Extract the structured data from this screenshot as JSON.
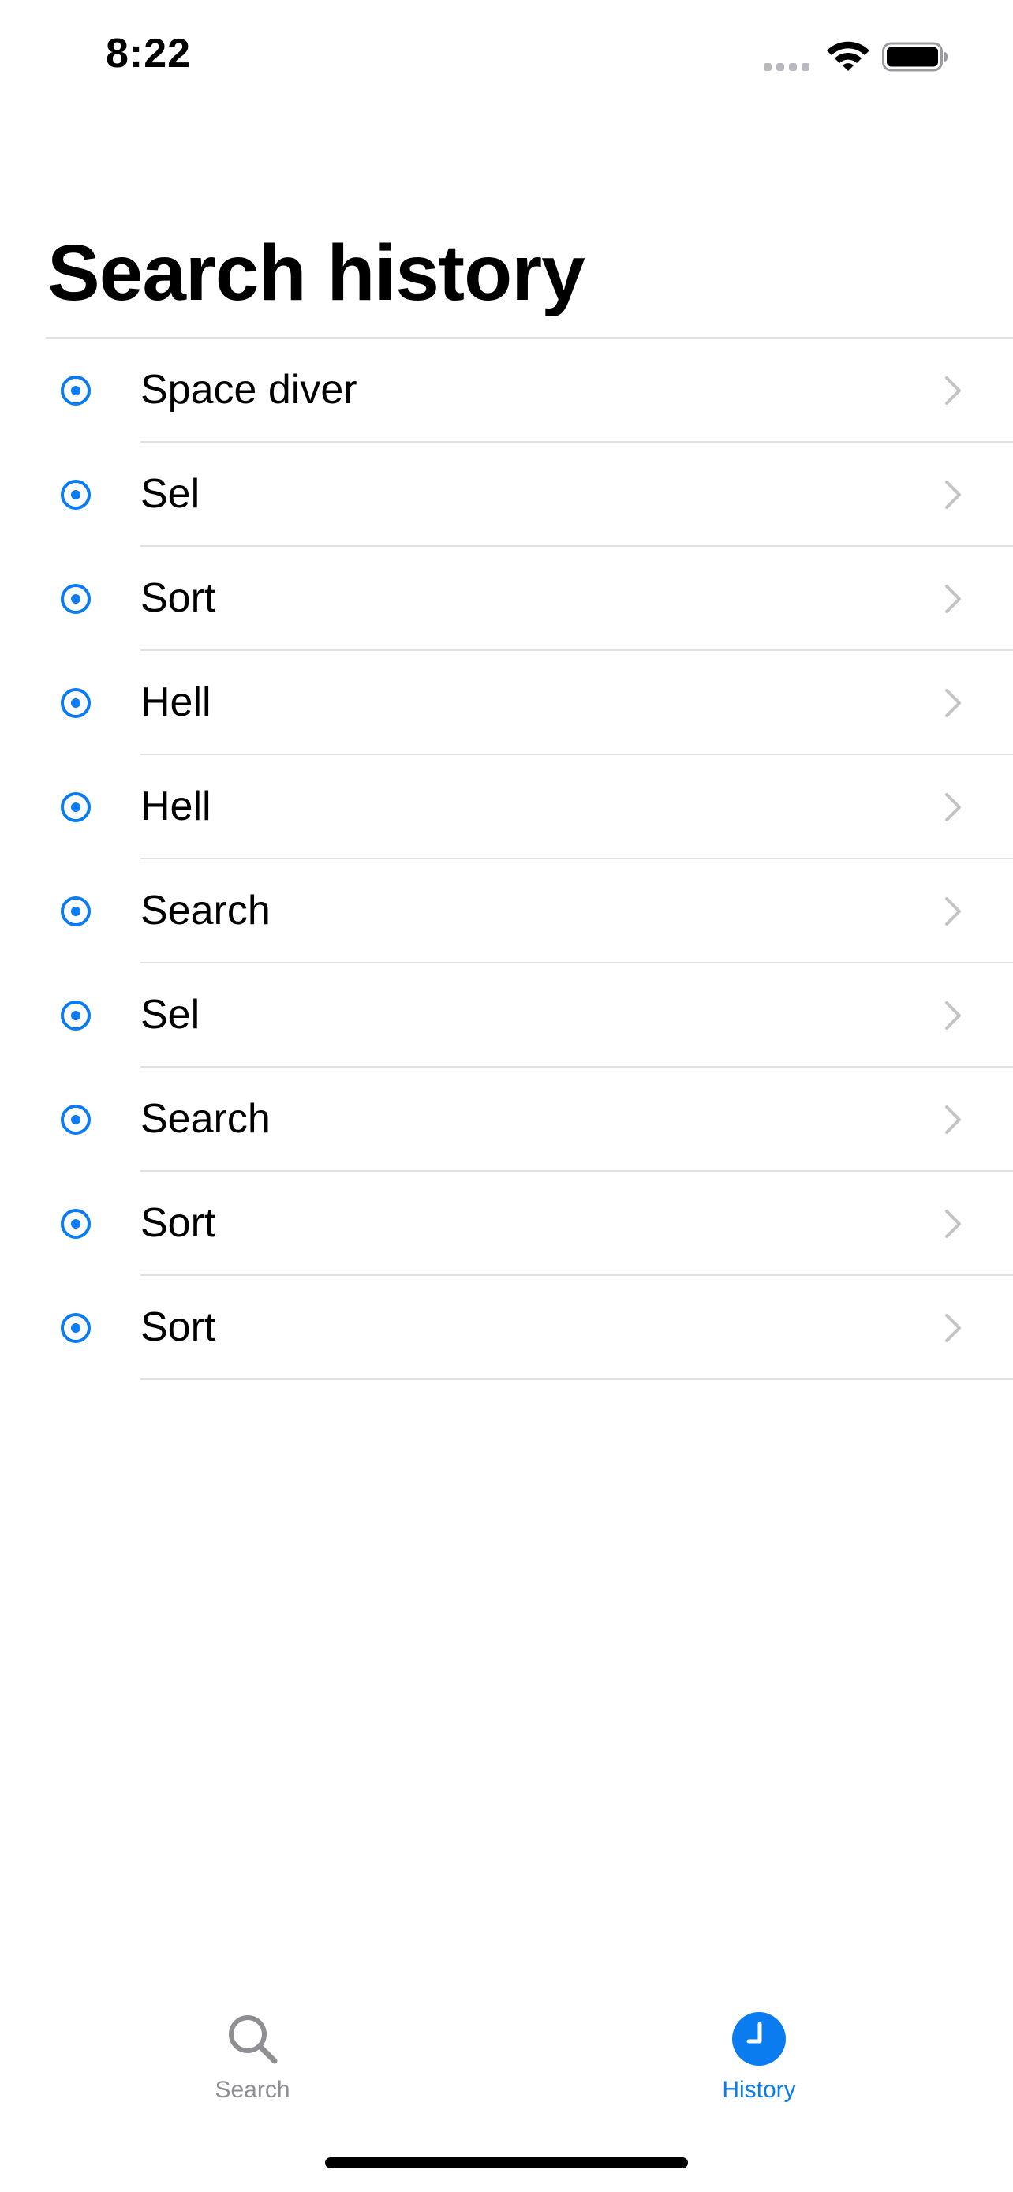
{
  "status_bar": {
    "time": "8:22"
  },
  "page": {
    "title": "Search history"
  },
  "history": {
    "items": [
      {
        "label": "Space diver"
      },
      {
        "label": "Sel"
      },
      {
        "label": "Sort"
      },
      {
        "label": "Hell"
      },
      {
        "label": "Hell"
      },
      {
        "label": "Search"
      },
      {
        "label": "Sel"
      },
      {
        "label": "Search"
      },
      {
        "label": "Sort"
      },
      {
        "label": "Sort"
      }
    ],
    "row_icon": "target-dot-icon",
    "row_accessory": "chevron-right-icon"
  },
  "tab_bar": {
    "tabs": [
      {
        "label": "Search",
        "icon": "magnifying-glass-icon",
        "selected": false
      },
      {
        "label": "History",
        "icon": "clock-icon",
        "selected": true
      }
    ]
  },
  "colors": {
    "accent": "#0a7cf0",
    "inactive": "#8e8e93",
    "divider": "#e0e0e3",
    "chevron": "#c4c4c7"
  }
}
